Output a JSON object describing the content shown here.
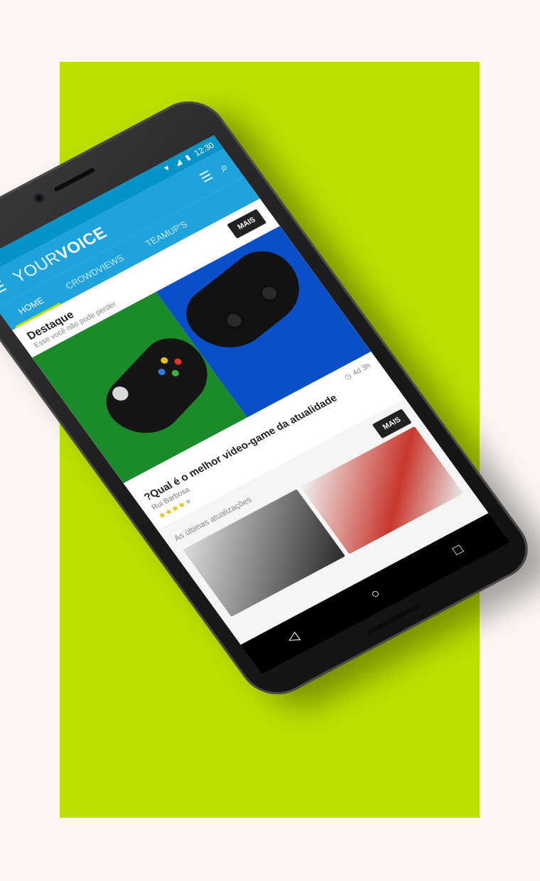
{
  "status_bar": {
    "time": "12:30",
    "wifi_icon": "wifi-icon",
    "signal_icon": "signal-icon",
    "battery_icon": "battery-icon"
  },
  "app_bar": {
    "logo_light": "YOUR",
    "logo_bold": "VOICE",
    "menu_icon": "menu-icon",
    "filter_icon": "filter-icon",
    "search_icon": "search-icon"
  },
  "tabs": [
    {
      "label": "HOME",
      "active": true
    },
    {
      "label": "CROWDVIEWS",
      "active": false
    },
    {
      "label": "TEAMUP'S",
      "active": false
    }
  ],
  "featured": {
    "title": "Destaque",
    "subtitle": "Esse você não pode perder",
    "more_label": "MAIS"
  },
  "article": {
    "title": "?Qual é o melhor video-game da atualidade",
    "author": "Rui Barbosa",
    "time_ago": "4d 3h",
    "rating": 4,
    "rating_max": 5
  },
  "updates": {
    "label": "As últimas atualizações",
    "more_label": "MAIS"
  },
  "nav_bar": {
    "back_icon": "back-icon",
    "home_icon": "home-icon",
    "recents_icon": "recents-icon"
  },
  "colors": {
    "background": "#fdf6f3",
    "panel": "#bde000",
    "app_blue": "#1ea3dd",
    "status_blue": "#0494c9",
    "tab_indicator": "#b8e000"
  }
}
